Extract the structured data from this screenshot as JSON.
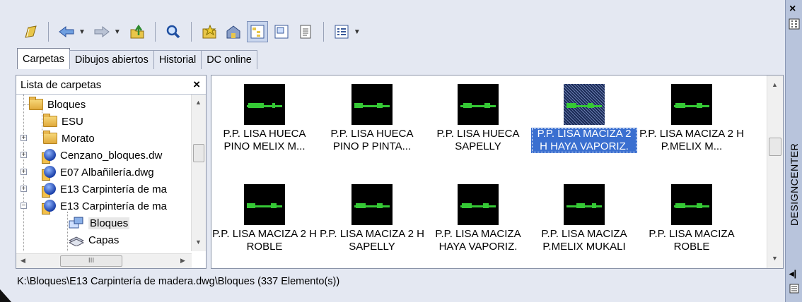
{
  "toolbar": {
    "buttons": [
      {
        "name": "load-icon"
      },
      {
        "name": "back-icon",
        "dropdown": true
      },
      {
        "name": "forward-icon",
        "dropdown": true
      },
      {
        "name": "up-icon"
      },
      {
        "name": "search-icon"
      },
      {
        "name": "favorites-icon"
      },
      {
        "name": "home-icon"
      },
      {
        "name": "tree-toggle-icon",
        "active": true
      },
      {
        "name": "preview-icon"
      },
      {
        "name": "description-icon"
      },
      {
        "name": "views-icon",
        "dropdown": true
      }
    ]
  },
  "tabs": [
    {
      "label": "Carpetas",
      "active": true
    },
    {
      "label": "Dibujos abiertos"
    },
    {
      "label": "Historial"
    },
    {
      "label": "DC online"
    }
  ],
  "folder_panel": {
    "title": "Lista de carpetas",
    "close": "×",
    "tree": [
      {
        "label": "Bloques",
        "icon": "folder-icon",
        "expander": ""
      },
      {
        "label": "ESU",
        "icon": "folder-icon",
        "expander": ""
      },
      {
        "label": "Morato",
        "icon": "folder-icon",
        "expander": "+"
      },
      {
        "label": "Cenzano_bloques.dw",
        "icon": "dwg-file-icon",
        "expander": "+"
      },
      {
        "label": "E07 Albañilería.dwg",
        "icon": "dwg-file-icon",
        "expander": "+"
      },
      {
        "label": "E13 Carpintería de ma",
        "icon": "dwg-file-icon",
        "expander": "+"
      },
      {
        "label": "E13 Carpintería de ma",
        "icon": "dwg-file-icon",
        "expander": "−"
      },
      {
        "label": "Bloques",
        "icon": "blocks-icon",
        "expander": "",
        "selected": true
      },
      {
        "label": "Capas",
        "icon": "layers-icon",
        "expander": ""
      }
    ],
    "hscroll_label": "III"
  },
  "items": [
    {
      "label": "P.P. LISA HUECA PINO MELIX M..."
    },
    {
      "label": "P.P. LISA HUECA PINO P PINTA..."
    },
    {
      "label": "P.P. LISA HUECA SAPELLY"
    },
    {
      "label": "P.P. LISA MACIZA 2 H HAYA VAPORIZ.",
      "selected": true
    },
    {
      "label": "P.P. LISA MACIZA 2 H P.MELIX M..."
    },
    {
      "label": "P.P. LISA MACIZA 2 H ROBLE"
    },
    {
      "label": "P.P. LISA MACIZA 2 H SAPELLY"
    },
    {
      "label": "P.P. LISA MACIZA HAYA VAPORIZ."
    },
    {
      "label": "P.P. LISA MACIZA P.MELIX MUKALI"
    },
    {
      "label": "P.P. LISA MACIZA ROBLE"
    }
  ],
  "status": "K:\\Bloques\\E13 Carpintería de madera.dwg\\Bloques (337 Elemento(s))",
  "sidebar": {
    "close": "×",
    "title": "DESIGNCENTER"
  }
}
